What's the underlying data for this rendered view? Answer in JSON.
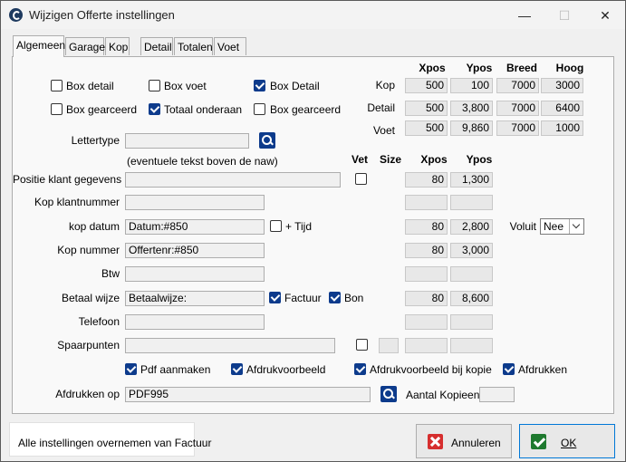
{
  "window": {
    "title": "Wijzigen Offerte instellingen"
  },
  "titlebar": {
    "minimize": "—",
    "maximize": "☐",
    "close": "✕"
  },
  "tabs": [
    "Algemeen",
    "Garage",
    "Kop",
    "Detail",
    "Totalen",
    "Voet"
  ],
  "boxes": {
    "checkboxes": [
      {
        "label": "Box detail",
        "checked": false
      },
      {
        "label": "Box voet",
        "checked": false
      },
      {
        "label": "Box Detail",
        "checked": true
      },
      {
        "label": "Box gearceerd",
        "checked": false
      },
      {
        "label": "Totaal onderaan",
        "checked": true
      },
      {
        "label": "Box gearceerd",
        "checked": false
      }
    ],
    "headers": [
      "Xpos",
      "Ypos",
      "Breed",
      "Hoog"
    ],
    "rows": [
      {
        "label": "Kop",
        "values": [
          "500",
          "100",
          "7000",
          "3000"
        ]
      },
      {
        "label": "Detail",
        "values": [
          "500",
          "3,800",
          "7000",
          "6400"
        ]
      },
      {
        "label": "Voet",
        "values": [
          "500",
          "9,860",
          "7000",
          "1000"
        ]
      }
    ]
  },
  "lettertype": {
    "label": "Lettertype",
    "value": "",
    "hint": "(eventuele tekst boven de naw)"
  },
  "fields_headers": {
    "vet": "Vet",
    "size": "Size",
    "xpos": "Xpos",
    "ypos": "Ypos"
  },
  "fields": [
    {
      "label": "Positie klant gegevens",
      "value": "",
      "xpos": "80",
      "ypos": "1,300"
    },
    {
      "label": "Kop klantnummer",
      "value": "",
      "xpos": "",
      "ypos": ""
    },
    {
      "label": "kop datum",
      "value": "Datum:#850",
      "extra_label": "+ Tijd",
      "extra_checked": false,
      "xpos": "80",
      "ypos": "2,800"
    },
    {
      "label": "Kop nummer",
      "value": "Offertenr:#850",
      "xpos": "80",
      "ypos": "3,000"
    },
    {
      "label": "Btw",
      "value": "",
      "xpos": "",
      "ypos": ""
    },
    {
      "label": "Betaal wijze",
      "value": "Betaalwijze:",
      "extra_label": "Factuur",
      "extra_checked": true,
      "extra2_label": "Bon",
      "extra2_checked": true,
      "xpos": "80",
      "ypos": "8,600"
    },
    {
      "label": "Telefoon",
      "value": "",
      "xpos": "",
      "ypos": ""
    },
    {
      "label": "Spaarpunten",
      "value": "",
      "size": "",
      "xpos": "",
      "ypos": ""
    }
  ],
  "voluit": {
    "label": "Voluit",
    "value": "Nee"
  },
  "options": [
    {
      "label": "Pdf aanmaken",
      "checked": true
    },
    {
      "label": "Afdrukvoorbeeld",
      "checked": true
    },
    {
      "label": "Afdrukvoorbeeld bij kopie",
      "checked": true
    },
    {
      "label": "Afdrukken",
      "checked": true
    }
  ],
  "printer": {
    "label": "Afdrukken op",
    "value": "PDF995"
  },
  "copies": {
    "label": "Aantal Kopieen",
    "value": ""
  },
  "copy_settings": "Alle instellingen overnemen van Factuur",
  "buttons": {
    "cancel": "Annuleren",
    "ok": "OK"
  }
}
